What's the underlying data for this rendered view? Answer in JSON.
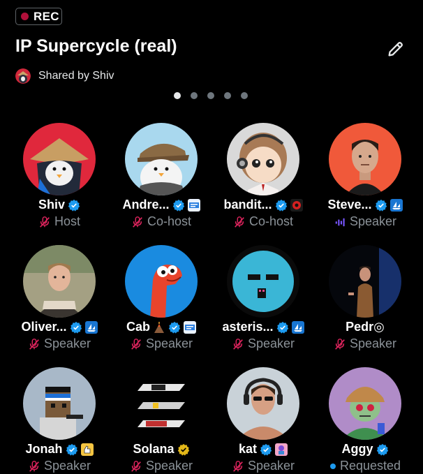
{
  "header": {
    "rec_label": "REC",
    "title": "IP Supercycle (real)",
    "shared_by": "Shared by Shiv"
  },
  "pagination": {
    "count": 5,
    "active": 0
  },
  "colors": {
    "background": "#000000",
    "muted_mic": "#e0245e",
    "verified": "#1d9bf0",
    "gold": "#e2b719",
    "speaking": "#7856ff",
    "requested": "#1d9bf0"
  },
  "participants": [
    {
      "name": "Shiv",
      "role": "Host",
      "badges": [
        "verified-blue-icon"
      ],
      "mic": "muted"
    },
    {
      "name": "Andre...",
      "role": "Co-host",
      "badges": [
        "verified-blue-icon",
        "affiliate-badge-icon"
      ],
      "mic": "muted"
    },
    {
      "name": "bandit...",
      "role": "Co-host",
      "badges": [
        "verified-blue-icon",
        "affiliate-badge-icon"
      ],
      "mic": "muted"
    },
    {
      "name": "Steve...",
      "role": "Speaker",
      "badges": [
        "verified-blue-icon",
        "affiliate-badge-icon"
      ],
      "mic": "speaking"
    },
    {
      "name": "Oliver...",
      "role": "Speaker",
      "badges": [
        "verified-blue-icon",
        "affiliate-badge-icon"
      ],
      "mic": "muted"
    },
    {
      "name": "Cab",
      "role": "Speaker",
      "badges": [
        "volcano-emoji-icon",
        "verified-blue-icon",
        "affiliate-badge-icon"
      ],
      "mic": "muted"
    },
    {
      "name": "asteris...",
      "role": "Speaker",
      "badges": [
        "verified-blue-icon",
        "affiliate-badge-icon"
      ],
      "mic": "muted"
    },
    {
      "name": "Pedr◎",
      "role": "Speaker",
      "badges": [],
      "mic": "muted"
    },
    {
      "name": "Jonah",
      "role": "Speaker",
      "badges": [
        "verified-blue-icon",
        "affiliate-badge-icon"
      ],
      "mic": "muted"
    },
    {
      "name": "Solana",
      "role": "Speaker",
      "badges": [
        "verified-gold-icon"
      ],
      "mic": "muted"
    },
    {
      "name": "kat",
      "role": "Speaker",
      "badges": [
        "verified-blue-icon",
        "affiliate-badge-icon"
      ],
      "mic": "muted"
    },
    {
      "name": "Aggy",
      "role": "Requested",
      "badges": [
        "verified-blue-icon"
      ],
      "mic": "requested"
    }
  ]
}
